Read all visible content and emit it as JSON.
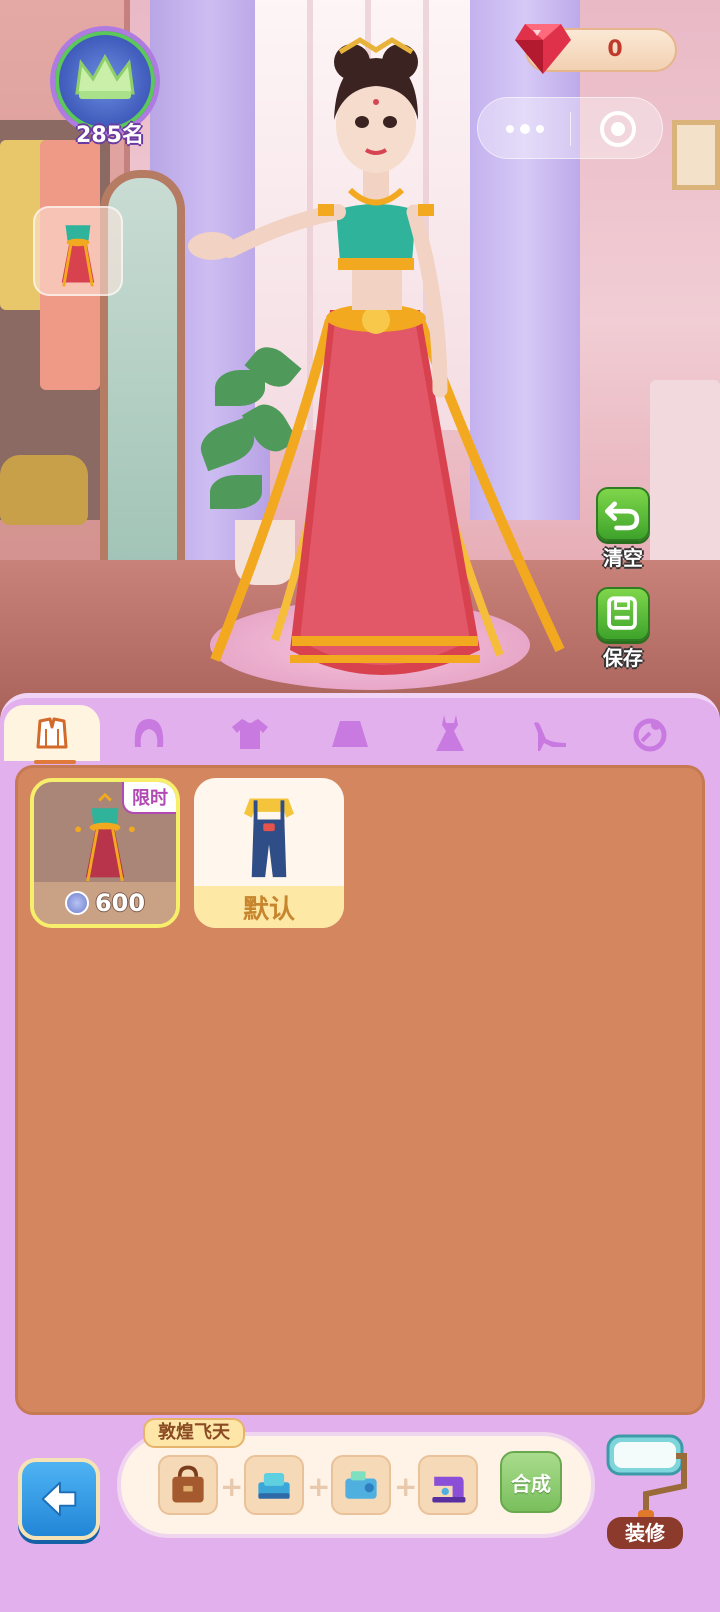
{
  "hud": {
    "rank_label": "285名",
    "gem_count": "0"
  },
  "side_actions": {
    "clear_label": "清空",
    "save_label": "保存"
  },
  "tabs": [
    {
      "name": "outfit-set",
      "icon": "outfit-set-icon",
      "active": true
    },
    {
      "name": "hair",
      "icon": "hair-icon",
      "active": false
    },
    {
      "name": "top",
      "icon": "shirt-icon",
      "active": false
    },
    {
      "name": "bottom",
      "icon": "skirt-icon",
      "active": false
    },
    {
      "name": "dress",
      "icon": "dress-icon",
      "active": false
    },
    {
      "name": "shoes",
      "icon": "high-heel-icon",
      "active": false
    },
    {
      "name": "accessory",
      "icon": "accessory-icon",
      "active": false
    }
  ],
  "items": [
    {
      "tag": "限时",
      "price": "600",
      "selected": true
    },
    {
      "label": "默认",
      "selected": false
    }
  ],
  "craft": {
    "title": "敦煌飞天",
    "synth_label": "合成"
  },
  "decor_label": "装修",
  "colors": {
    "panel": "#e3b0ee",
    "list_bg": "#d4875f",
    "accent_green": "#5fbf3a",
    "back_blue": "#2f97e6"
  }
}
